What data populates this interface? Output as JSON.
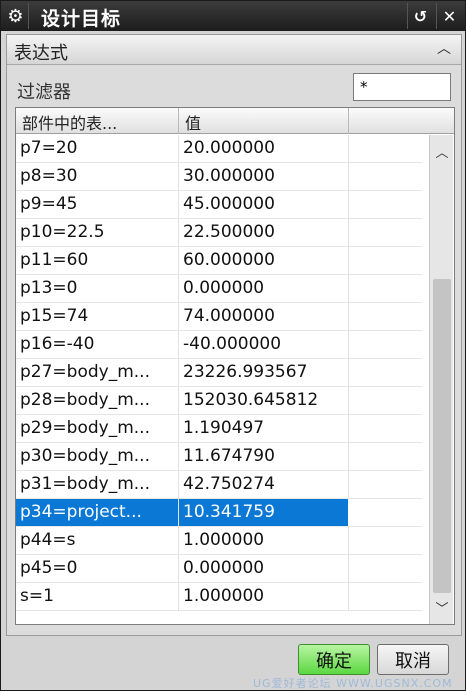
{
  "window": {
    "title": "设计目标",
    "gear_icon": "gear-icon",
    "reset_glyph": "↺",
    "close_glyph": "✕"
  },
  "group": {
    "title": "表达式",
    "collapse_glyph": "︿"
  },
  "filter": {
    "label": "过滤器",
    "value": "*"
  },
  "table": {
    "headers": [
      "部件中的表...",
      "值",
      ""
    ],
    "rows": [
      {
        "name": "p7=20",
        "value": "20.000000"
      },
      {
        "name": "p8=30",
        "value": "30.000000"
      },
      {
        "name": "p9=45",
        "value": "45.000000"
      },
      {
        "name": "p10=22.5",
        "value": "22.500000"
      },
      {
        "name": "p11=60",
        "value": "60.000000"
      },
      {
        "name": "p13=0",
        "value": "0.000000"
      },
      {
        "name": "p15=74",
        "value": "74.000000"
      },
      {
        "name": "p16=-40",
        "value": "-40.000000"
      },
      {
        "name": "p27=body_m...",
        "value": "23226.993567"
      },
      {
        "name": "p28=body_m...",
        "value": "152030.645812"
      },
      {
        "name": "p29=body_m...",
        "value": "1.190497"
      },
      {
        "name": "p30=body_m...",
        "value": "11.674790"
      },
      {
        "name": "p31=body_m...",
        "value": "42.750274"
      },
      {
        "name": "p34=project...",
        "value": "10.341759",
        "selected": true
      },
      {
        "name": "p44=s",
        "value": "1.000000"
      },
      {
        "name": "p45=0",
        "value": "0.000000"
      },
      {
        "name": "s=1",
        "value": "1.000000"
      }
    ]
  },
  "scrollbar": {
    "up_glyph": "︿",
    "down_glyph": "﹀"
  },
  "buttons": {
    "ok": "确定",
    "cancel": "取消"
  },
  "watermark": "UG爱好者论坛 WWW.UGSNX.COM",
  "colors": {
    "selection": "#0a78d4",
    "ok_button": "#5cd842"
  }
}
